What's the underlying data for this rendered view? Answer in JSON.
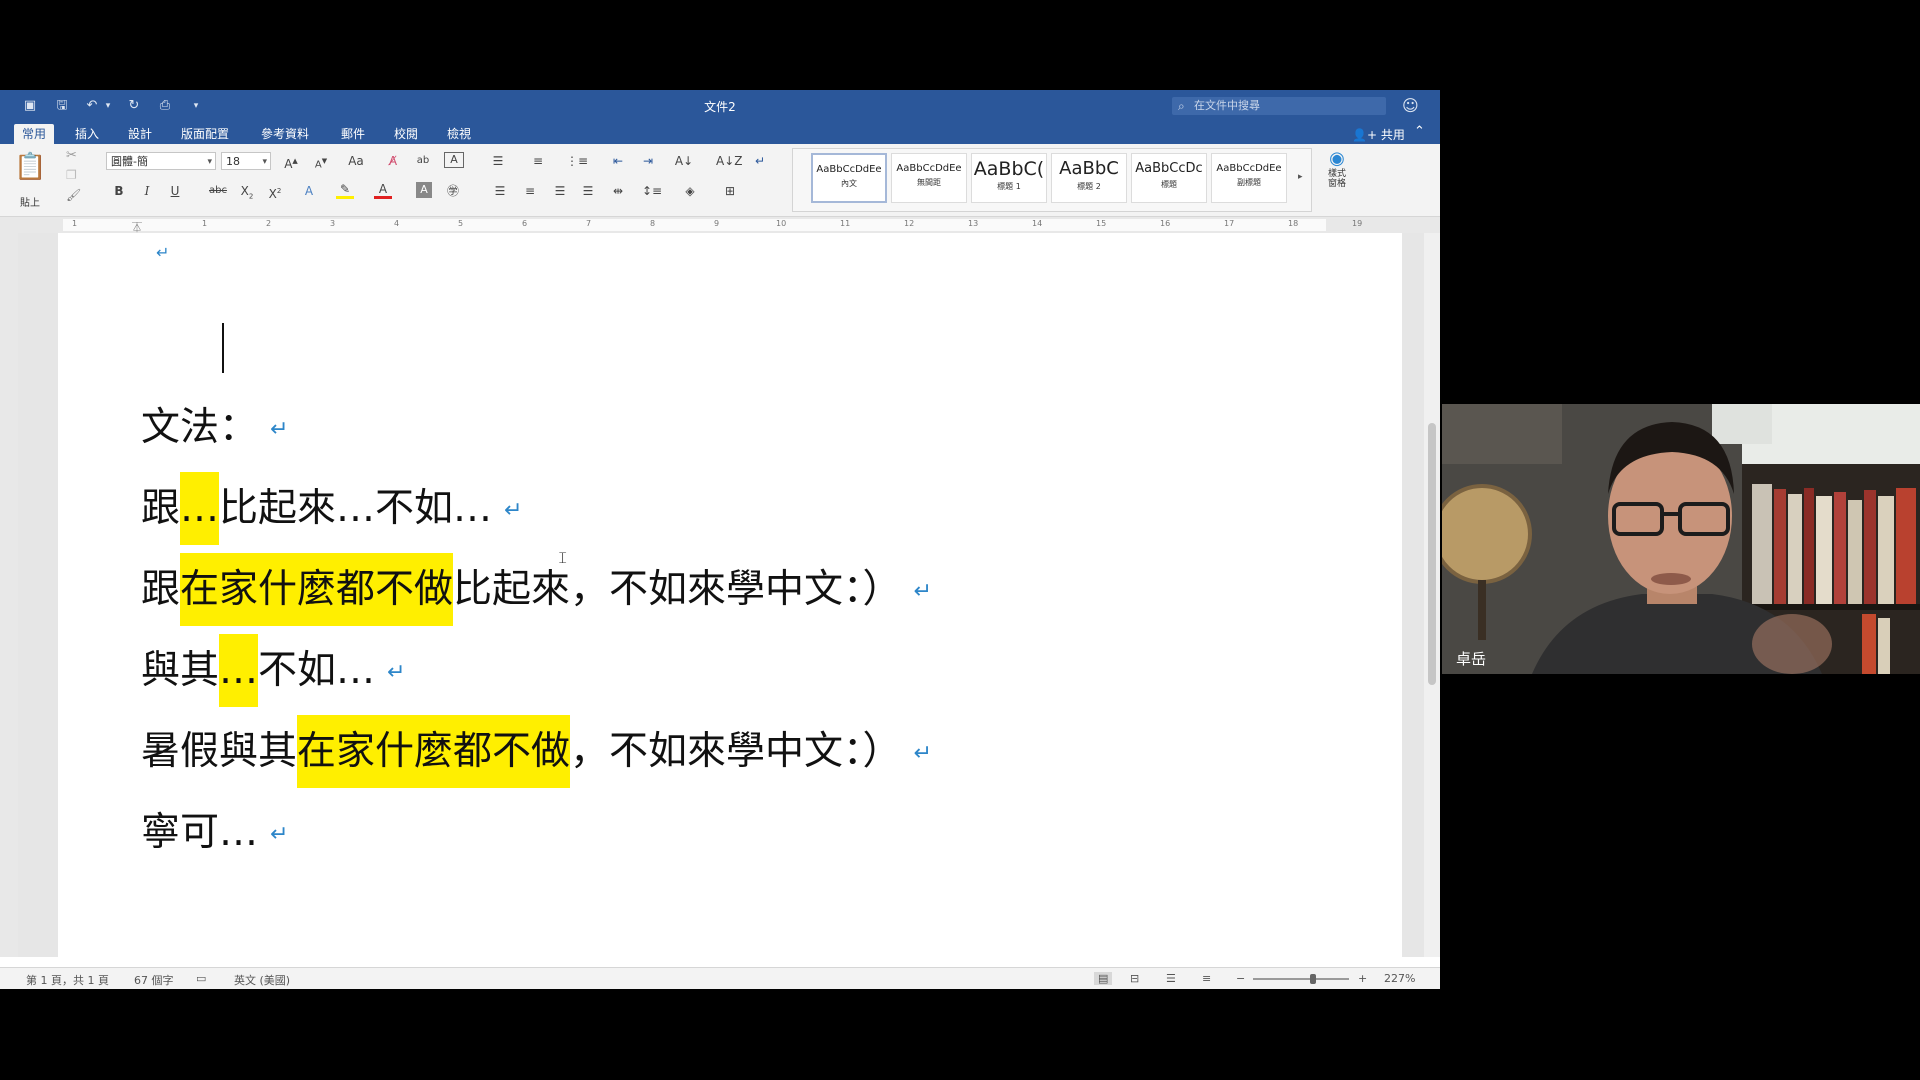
{
  "window": {
    "title": "文件2"
  },
  "quick_access": [
    "sidebar-icon",
    "save-icon",
    "undo-icon",
    "redo-icon",
    "print-icon",
    "customize-icon"
  ],
  "search": {
    "placeholder": "在文件中搜尋"
  },
  "tabs": [
    {
      "label": "常用",
      "active": true
    },
    {
      "label": "插入"
    },
    {
      "label": "設計"
    },
    {
      "label": "版面配置"
    },
    {
      "label": "參考資料"
    },
    {
      "label": "郵件"
    },
    {
      "label": "校閱"
    },
    {
      "label": "檢視"
    }
  ],
  "share_label": "共用",
  "ribbon": {
    "paste_label": "貼上",
    "font_name": "圓體-簡",
    "font_size": "18",
    "styles": [
      {
        "preview": "AaBbCcDdEe",
        "name": "內文",
        "selected": true
      },
      {
        "preview": "AaBbCcDdEe",
        "name": "無間距"
      },
      {
        "preview": "AaBbC(",
        "name": "標題 1"
      },
      {
        "preview": "AaBbC",
        "name": "標題 2"
      },
      {
        "preview": "AaBbCcDc",
        "name": "標題"
      },
      {
        "preview": "AaBbCcDdEe",
        "name": "副標題"
      }
    ],
    "styles_pane_label": "樣式\n窗格"
  },
  "ruler_numbers": [
    "1",
    "1",
    "2",
    "3",
    "4",
    "5",
    "6",
    "7",
    "8",
    "9",
    "10",
    "11",
    "12",
    "13",
    "14",
    "15",
    "16",
    "17",
    "18",
    "19"
  ],
  "document": {
    "lines": [
      {
        "parts": [
          {
            "t": "文法："
          }
        ]
      },
      {
        "parts": [
          {
            "t": "跟"
          },
          {
            "t": "…",
            "hl": true
          },
          {
            "t": "比起來…不如…"
          }
        ]
      },
      {
        "parts": [
          {
            "t": "跟"
          },
          {
            "t": "在家什麼都不做",
            "hl": true
          },
          {
            "t": "比起來，不如來學中文：）"
          }
        ]
      },
      {
        "parts": [
          {
            "t": "與其"
          },
          {
            "t": "…",
            "hl": true
          },
          {
            "t": "不如…"
          }
        ]
      },
      {
        "parts": [
          {
            "t": "暑假與其"
          },
          {
            "t": "在家什麼都不做",
            "hl": true
          },
          {
            "t": "，不如來學中文：）"
          }
        ]
      },
      {
        "parts": [
          {
            "t": "寧可…"
          }
        ]
      }
    ],
    "paragraph_mark": "↵"
  },
  "status": {
    "page": "第 1 頁，共 1 頁",
    "words": "67 個字",
    "language": "英文 (美國)",
    "zoom": "227%"
  },
  "video": {
    "participant_name": "卓岳"
  },
  "colors": {
    "word_blue": "#2b579a",
    "highlight": "#ffef00",
    "para_mark": "#2d86c9"
  }
}
